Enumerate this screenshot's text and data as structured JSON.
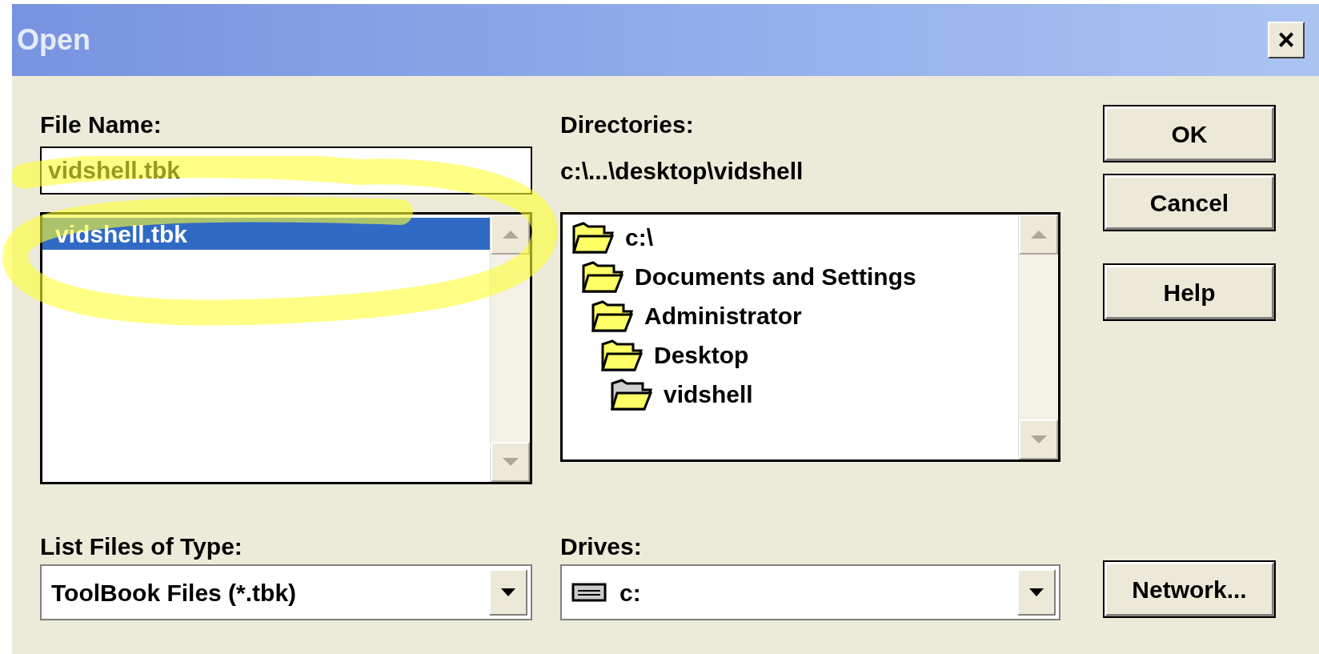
{
  "window": {
    "title": "Open",
    "close": "×"
  },
  "file_name": {
    "label": "File Name:",
    "value": "vidshell.tbk"
  },
  "files": [
    {
      "name": "vidshell.tbk",
      "selected": true
    }
  ],
  "directories": {
    "label": "Directories:",
    "path": "c:\\...\\desktop\\vidshell",
    "tree": [
      {
        "name": "c:\\",
        "current": false,
        "children": [
          {
            "name": "Documents and Settings",
            "current": false,
            "children": [
              {
                "name": "Administrator",
                "current": false,
                "children": [
                  {
                    "name": "Desktop",
                    "current": false,
                    "children": [
                      {
                        "name": "vidshell",
                        "current": true
                      }
                    ]
                  }
                ]
              }
            ]
          }
        ]
      }
    ]
  },
  "file_type": {
    "label": "List Files of Type:",
    "value": "ToolBook Files (*.tbk)"
  },
  "drives": {
    "label": "Drives:",
    "value": "c:"
  },
  "buttons": [
    {
      "label": "OK"
    },
    {
      "label": "Cancel"
    },
    {
      "label": "Help"
    }
  ],
  "network_button": {
    "label": "Network..."
  }
}
